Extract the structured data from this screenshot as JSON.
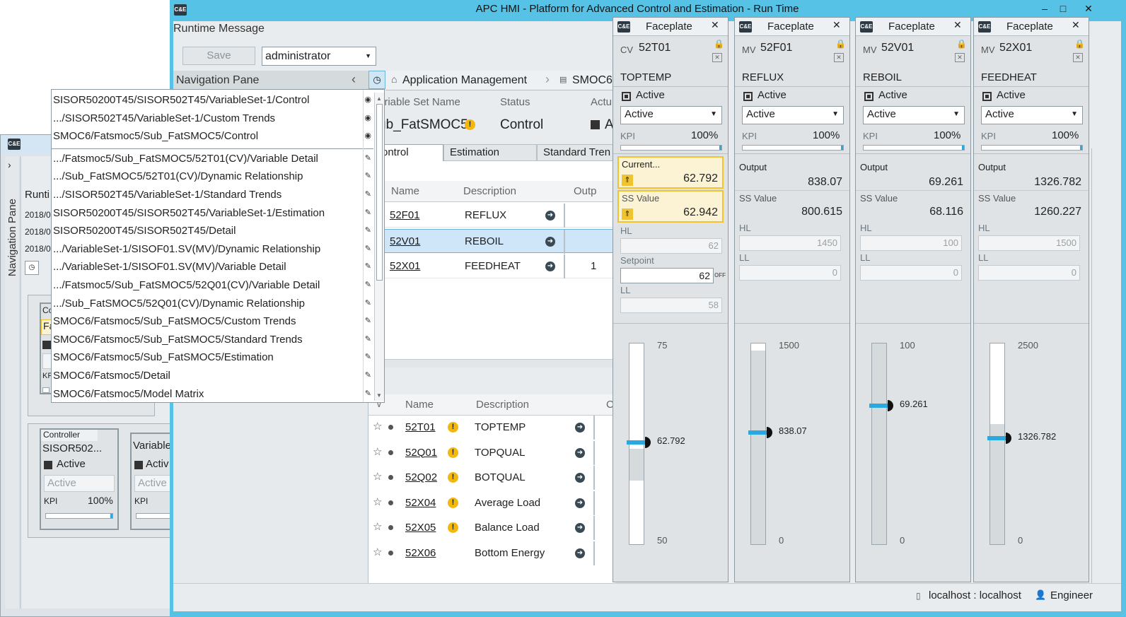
{
  "main_window": {
    "title": "APC HMI - Platform for Advanced Control and Estimation - Run Time",
    "logo_text": "C&E",
    "controls": [
      "–",
      "□",
      "✕"
    ]
  },
  "runtime_message": "Runtime Message",
  "toolbar": {
    "save_label": "Save",
    "user_select": "administrator"
  },
  "nav_pane": {
    "title": "Navigation Pane"
  },
  "breadcrumb": {
    "item1": "Application Management",
    "item2": "SMOC6"
  },
  "variable_set": {
    "header_name": "ariable Set Name",
    "header_status": "Status",
    "header_actual": "Actu",
    "name_value": "ub_FatSMOC5",
    "status_value": "Control",
    "actual_value": "A"
  },
  "tabs": [
    "ontrol",
    "Estimation",
    "Standard Tren"
  ],
  "mv_table": {
    "col_name": "Name",
    "col_description": "Description",
    "col_output": "Outp",
    "rows": [
      {
        "name": "52F01",
        "description": "REFLUX",
        "extra": ""
      },
      {
        "name": "52V01",
        "description": "REBOIL",
        "extra": ""
      },
      {
        "name": "52X01",
        "description": "FEEDHEAT",
        "extra": "1"
      }
    ]
  },
  "cv_table": {
    "col_name": "Name",
    "col_description": "Description",
    "col_extra": "C",
    "rows": [
      {
        "name": "52T01",
        "description": "TOPTEMP",
        "warn": true
      },
      {
        "name": "52Q01",
        "description": "TOPQUAL",
        "warn": true
      },
      {
        "name": "52Q02",
        "description": "BOTQUAL",
        "warn": true
      },
      {
        "name": "52X04",
        "description": "Average Load",
        "warn": true
      },
      {
        "name": "52X05",
        "description": "Balance Load",
        "warn": true
      },
      {
        "name": "52X06",
        "description": "Bottom Energy",
        "warn": false
      }
    ]
  },
  "nav_dropdown": {
    "items": [
      {
        "label": "SISOR50200T45/SISOR502T45/VariableSet-1/Control",
        "icon": "view-icon"
      },
      {
        "label": ".../SISOR502T45/VariableSet-1/Custom Trends",
        "icon": "view-icon"
      },
      {
        "label": "SMOC6/Fatsmoc5/Sub_FatSMOC5/Control",
        "icon": "view-icon"
      },
      {
        "label": ".../Fatsmoc5/Sub_FatSMOC5/52T01(CV)/Variable Detail",
        "icon": "pin-icon"
      },
      {
        "label": ".../Sub_FatSMOC5/52T01(CV)/Dynamic Relationship",
        "icon": "pin-icon"
      },
      {
        "label": ".../SISOR502T45/VariableSet-1/Standard Trends",
        "icon": "pin-icon"
      },
      {
        "label": "SISOR50200T45/SISOR502T45/VariableSet-1/Estimation",
        "icon": "pin-icon"
      },
      {
        "label": "SISOR50200T45/SISOR502T45/Detail",
        "icon": "pin-icon"
      },
      {
        "label": ".../VariableSet-1/SISOF01.SV(MV)/Dynamic Relationship",
        "icon": "pin-icon"
      },
      {
        "label": ".../VariableSet-1/SISOF01.SV(MV)/Variable Detail",
        "icon": "pin-icon"
      },
      {
        "label": ".../Fatsmoc5/Sub_FatSMOC5/52Q01(CV)/Variable Detail",
        "icon": "pin-icon"
      },
      {
        "label": ".../Sub_FatSMOC5/52Q01(CV)/Dynamic Relationship",
        "icon": "pin-icon"
      },
      {
        "label": "SMOC6/Fatsmoc5/Sub_FatSMOC5/Custom Trends",
        "icon": "pin-icon"
      },
      {
        "label": "SMOC6/Fatsmoc5/Sub_FatSMOC5/Standard Trends",
        "icon": "pin-icon"
      },
      {
        "label": "SMOC6/Fatsmoc5/Sub_FatSMOC5/Estimation",
        "icon": "pin-icon"
      },
      {
        "label": "SMOC6/Fatsmoc5/Detail",
        "icon": "pin-icon"
      },
      {
        "label": "SMOC6/Fatsmoc5/Model Matrix",
        "icon": "pin-icon"
      }
    ]
  },
  "background_window": {
    "nav_label": "Navigation Pane",
    "runtime_label": "Runti",
    "dates": [
      "2018/0",
      "2018/0",
      "2018/0"
    ],
    "controller_tag": "Controller",
    "controller_name": "SISOR502...",
    "active_label": "Active",
    "dropdown_value": "Active",
    "kpi_label": "KPI",
    "kpi_value": "100%",
    "variable_label": "Variable",
    "variable_active": "Activ",
    "variable_dropdown": "Active",
    "variable_kpi": "KPI",
    "upper_card_prefix": "Co",
    "upper_card_text": "Fa"
  },
  "status_bar": {
    "host": "localhost : localhost",
    "role": "Engineer"
  },
  "faceplates": [
    {
      "title": "Faceplate",
      "type": "CV",
      "tag": "52T01",
      "description": "TOPTEMP",
      "active_label": "Active",
      "mode": "Active",
      "kpi_label": "KPI",
      "kpi_value": "100%",
      "current_label": "Current...",
      "current_value": "62.792",
      "ss_label": "SS Value",
      "ss_value": "62.942",
      "hl_label": "HL",
      "hl_value": "62",
      "setpoint_label": "Setpoint",
      "setpoint_value": "62",
      "setpoint_off": "OFF",
      "ll_label": "LL",
      "ll_value": "58",
      "scale_top": "75",
      "scale_bottom": "50",
      "marker_value": "62.792",
      "scale_min": 50,
      "scale_max": 75,
      "current": 62.792
    },
    {
      "title": "Faceplate",
      "type": "MV",
      "tag": "52F01",
      "description": "REFLUX",
      "active_label": "Active",
      "mode": "Active",
      "kpi_label": "KPI",
      "kpi_value": "100%",
      "output_label": "Output",
      "output_value": "838.07",
      "ss_label": "SS Value",
      "ss_value": "800.615",
      "hl_label": "HL",
      "hl_value": "1450",
      "ll_label": "LL",
      "ll_value": "0",
      "scale_top": "1500",
      "scale_bottom": "0",
      "marker_value": "838.07",
      "scale_min": 0,
      "scale_max": 1500,
      "current": 838.07
    },
    {
      "title": "Faceplate",
      "type": "MV",
      "tag": "52V01",
      "description": "REBOIL",
      "active_label": "Active",
      "mode": "Active",
      "kpi_label": "KPI",
      "kpi_value": "100%",
      "output_label": "Output",
      "output_value": "69.261",
      "ss_label": "SS Value",
      "ss_value": "68.116",
      "hl_label": "HL",
      "hl_value": "100",
      "ll_label": "LL",
      "ll_value": "0",
      "scale_top": "100",
      "scale_bottom": "0",
      "marker_value": "69.261",
      "scale_min": 0,
      "scale_max": 100,
      "current": 69.261
    },
    {
      "title": "Faceplate",
      "type": "MV",
      "tag": "52X01",
      "description": "FEEDHEAT",
      "active_label": "Active",
      "mode": "Active",
      "kpi_label": "KPI",
      "kpi_value": "100%",
      "output_label": "Output",
      "output_value": "1326.782",
      "ss_label": "SS Value",
      "ss_value": "1260.227",
      "hl_label": "HL",
      "hl_value": "1500",
      "ll_label": "LL",
      "ll_value": "0",
      "scale_top": "2500",
      "scale_bottom": "0",
      "marker_value": "1326.782",
      "scale_min": 0,
      "scale_max": 2500,
      "current": 1326.782
    }
  ]
}
